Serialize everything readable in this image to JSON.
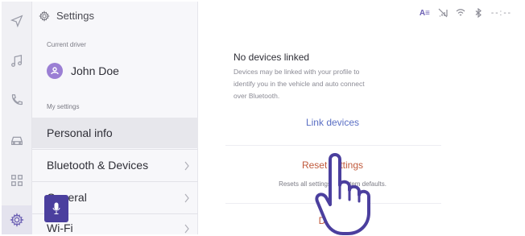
{
  "window": {
    "title": "Settings"
  },
  "status_bar": {
    "font_icon": "A≡",
    "icons": [
      "no-signal-icon",
      "wifi-icon",
      "bluetooth-icon"
    ],
    "time": "--:--"
  },
  "rail": {
    "items": [
      {
        "name": "navigation",
        "icon": "navigation-arrow-icon"
      },
      {
        "name": "music",
        "icon": "music-note-icon"
      },
      {
        "name": "phone",
        "icon": "phone-icon"
      },
      {
        "name": "vehicle",
        "icon": "car-icon"
      },
      {
        "name": "apps",
        "icon": "grid-icon"
      },
      {
        "name": "settings",
        "icon": "gear-icon",
        "active": true
      }
    ]
  },
  "sidebar": {
    "header": "Settings",
    "current_driver_label": "Current driver",
    "driver_name": "John Doe",
    "my_settings_label": "My settings",
    "items": [
      {
        "label": "Personal info",
        "selected": true
      },
      {
        "label": "Bluetooth & Devices"
      },
      {
        "label": "General"
      },
      {
        "label": "Wi-Fi"
      }
    ]
  },
  "main": {
    "title": "No devices linked",
    "description": "Devices may be linked with your profile to identify you in the vehicle and auto connect over Bluetooth.",
    "link_devices": "Link devices",
    "reset_settings": "Reset settings",
    "reset_description": "Resets all settings to system defaults.",
    "delete_label": "Delete"
  },
  "colors": {
    "accent": "#6b5fb3",
    "link": "#5a6fc4",
    "danger": "#c05a3c",
    "mic_button": "#4b3f9e"
  }
}
